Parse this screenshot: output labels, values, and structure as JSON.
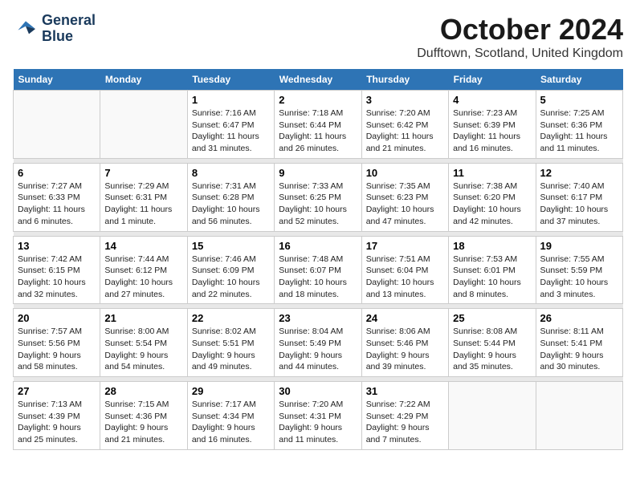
{
  "logo": {
    "line1": "General",
    "line2": "Blue"
  },
  "title": "October 2024",
  "location": "Dufftown, Scotland, United Kingdom",
  "headers": [
    "Sunday",
    "Monday",
    "Tuesday",
    "Wednesday",
    "Thursday",
    "Friday",
    "Saturday"
  ],
  "weeks": [
    [
      {
        "date": "",
        "info": ""
      },
      {
        "date": "",
        "info": ""
      },
      {
        "date": "1",
        "info": "Sunrise: 7:16 AM\nSunset: 6:47 PM\nDaylight: 11 hours and 31 minutes."
      },
      {
        "date": "2",
        "info": "Sunrise: 7:18 AM\nSunset: 6:44 PM\nDaylight: 11 hours and 26 minutes."
      },
      {
        "date": "3",
        "info": "Sunrise: 7:20 AM\nSunset: 6:42 PM\nDaylight: 11 hours and 21 minutes."
      },
      {
        "date": "4",
        "info": "Sunrise: 7:23 AM\nSunset: 6:39 PM\nDaylight: 11 hours and 16 minutes."
      },
      {
        "date": "5",
        "info": "Sunrise: 7:25 AM\nSunset: 6:36 PM\nDaylight: 11 hours and 11 minutes."
      }
    ],
    [
      {
        "date": "6",
        "info": "Sunrise: 7:27 AM\nSunset: 6:33 PM\nDaylight: 11 hours and 6 minutes."
      },
      {
        "date": "7",
        "info": "Sunrise: 7:29 AM\nSunset: 6:31 PM\nDaylight: 11 hours and 1 minute."
      },
      {
        "date": "8",
        "info": "Sunrise: 7:31 AM\nSunset: 6:28 PM\nDaylight: 10 hours and 56 minutes."
      },
      {
        "date": "9",
        "info": "Sunrise: 7:33 AM\nSunset: 6:25 PM\nDaylight: 10 hours and 52 minutes."
      },
      {
        "date": "10",
        "info": "Sunrise: 7:35 AM\nSunset: 6:23 PM\nDaylight: 10 hours and 47 minutes."
      },
      {
        "date": "11",
        "info": "Sunrise: 7:38 AM\nSunset: 6:20 PM\nDaylight: 10 hours and 42 minutes."
      },
      {
        "date": "12",
        "info": "Sunrise: 7:40 AM\nSunset: 6:17 PM\nDaylight: 10 hours and 37 minutes."
      }
    ],
    [
      {
        "date": "13",
        "info": "Sunrise: 7:42 AM\nSunset: 6:15 PM\nDaylight: 10 hours and 32 minutes."
      },
      {
        "date": "14",
        "info": "Sunrise: 7:44 AM\nSunset: 6:12 PM\nDaylight: 10 hours and 27 minutes."
      },
      {
        "date": "15",
        "info": "Sunrise: 7:46 AM\nSunset: 6:09 PM\nDaylight: 10 hours and 22 minutes."
      },
      {
        "date": "16",
        "info": "Sunrise: 7:48 AM\nSunset: 6:07 PM\nDaylight: 10 hours and 18 minutes."
      },
      {
        "date": "17",
        "info": "Sunrise: 7:51 AM\nSunset: 6:04 PM\nDaylight: 10 hours and 13 minutes."
      },
      {
        "date": "18",
        "info": "Sunrise: 7:53 AM\nSunset: 6:01 PM\nDaylight: 10 hours and 8 minutes."
      },
      {
        "date": "19",
        "info": "Sunrise: 7:55 AM\nSunset: 5:59 PM\nDaylight: 10 hours and 3 minutes."
      }
    ],
    [
      {
        "date": "20",
        "info": "Sunrise: 7:57 AM\nSunset: 5:56 PM\nDaylight: 9 hours and 58 minutes."
      },
      {
        "date": "21",
        "info": "Sunrise: 8:00 AM\nSunset: 5:54 PM\nDaylight: 9 hours and 54 minutes."
      },
      {
        "date": "22",
        "info": "Sunrise: 8:02 AM\nSunset: 5:51 PM\nDaylight: 9 hours and 49 minutes."
      },
      {
        "date": "23",
        "info": "Sunrise: 8:04 AM\nSunset: 5:49 PM\nDaylight: 9 hours and 44 minutes."
      },
      {
        "date": "24",
        "info": "Sunrise: 8:06 AM\nSunset: 5:46 PM\nDaylight: 9 hours and 39 minutes."
      },
      {
        "date": "25",
        "info": "Sunrise: 8:08 AM\nSunset: 5:44 PM\nDaylight: 9 hours and 35 minutes."
      },
      {
        "date": "26",
        "info": "Sunrise: 8:11 AM\nSunset: 5:41 PM\nDaylight: 9 hours and 30 minutes."
      }
    ],
    [
      {
        "date": "27",
        "info": "Sunrise: 7:13 AM\nSunset: 4:39 PM\nDaylight: 9 hours and 25 minutes."
      },
      {
        "date": "28",
        "info": "Sunrise: 7:15 AM\nSunset: 4:36 PM\nDaylight: 9 hours and 21 minutes."
      },
      {
        "date": "29",
        "info": "Sunrise: 7:17 AM\nSunset: 4:34 PM\nDaylight: 9 hours and 16 minutes."
      },
      {
        "date": "30",
        "info": "Sunrise: 7:20 AM\nSunset: 4:31 PM\nDaylight: 9 hours and 11 minutes."
      },
      {
        "date": "31",
        "info": "Sunrise: 7:22 AM\nSunset: 4:29 PM\nDaylight: 9 hours and 7 minutes."
      },
      {
        "date": "",
        "info": ""
      },
      {
        "date": "",
        "info": ""
      }
    ]
  ]
}
